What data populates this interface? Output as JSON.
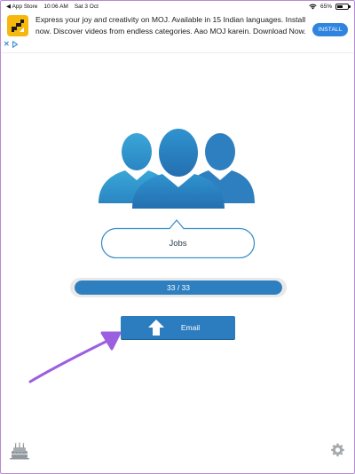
{
  "status_bar": {
    "back_app": "◀ App Store",
    "time": "10:06 AM",
    "date": "Sat 3 Oct",
    "battery": "65%",
    "battery_level": 0.65
  },
  "ad": {
    "text": "Express your joy and creativity on MOJ. Available in 15 Indian languages. Install now. Discover videos from endless categories. Aao MOJ karein. Download Now.",
    "install_label": "INSTALL",
    "colors": {
      "logo_bg": "#f6b80e",
      "button_bg": "#2f84e0"
    }
  },
  "main": {
    "group_name": "Jobs",
    "progress": {
      "label": "33 / 33",
      "current": 33,
      "total": 33
    },
    "email_label": "Email"
  },
  "icons": {
    "contacts": "people-group-icon",
    "upload": "up-arrow-icon",
    "annotation": "arrow-annotation",
    "birthday": "cake-icon",
    "settings": "gear-icon"
  },
  "colors": {
    "accent": "#2c7cc0",
    "annotation_arrow": "#9b5fe0"
  }
}
